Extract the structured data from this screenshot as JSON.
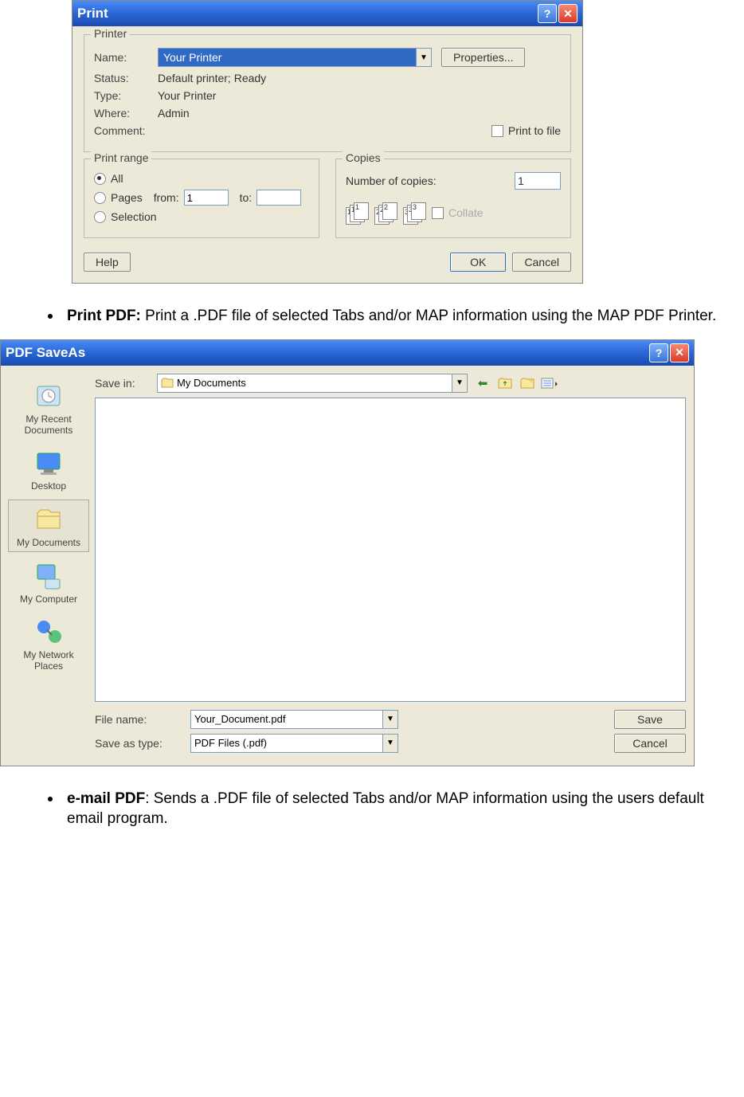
{
  "print_dialog": {
    "title": "Print",
    "printer_legend": "Printer",
    "name_label": "Name:",
    "name_value": "Your Printer",
    "properties_btn": "Properties...",
    "status_label": "Status:",
    "status_value": "Default printer; Ready",
    "type_label": "Type:",
    "type_value": "Your Printer",
    "where_label": "Where:",
    "where_value": "Admin",
    "comment_label": "Comment:",
    "print_to_file": "Print to file",
    "range_legend": "Print range",
    "range_all": "All",
    "range_pages": "Pages",
    "range_from": "from:",
    "range_from_val": "1",
    "range_to": "to:",
    "range_selection": "Selection",
    "copies_legend": "Copies",
    "copies_label": "Number of copies:",
    "copies_value": "1",
    "collate": "Collate",
    "help_btn": "Help",
    "ok_btn": "OK",
    "cancel_btn": "Cancel"
  },
  "bullet1": {
    "bold": "Print PDF:",
    "text": " Print a .PDF file of selected Tabs and/or MAP information using the MAP PDF Printer."
  },
  "save_dialog": {
    "title": "PDF SaveAs",
    "save_in_label": "Save in:",
    "save_in_value": "My Documents",
    "places": {
      "recent": "My Recent Documents",
      "desktop": "Desktop",
      "docs": "My Documents",
      "computer": "My Computer",
      "network": "My Network Places"
    },
    "filename_label": "File name:",
    "filename_value": "Your_Document.pdf",
    "type_label": "Save as type:",
    "type_value": "PDF Files (.pdf)",
    "save_btn": "Save",
    "cancel_btn": "Cancel"
  },
  "bullet2": {
    "bold": "e-mail PDF",
    "text": ": Sends a .PDF file of selected Tabs and/or MAP information using the users default email program."
  }
}
